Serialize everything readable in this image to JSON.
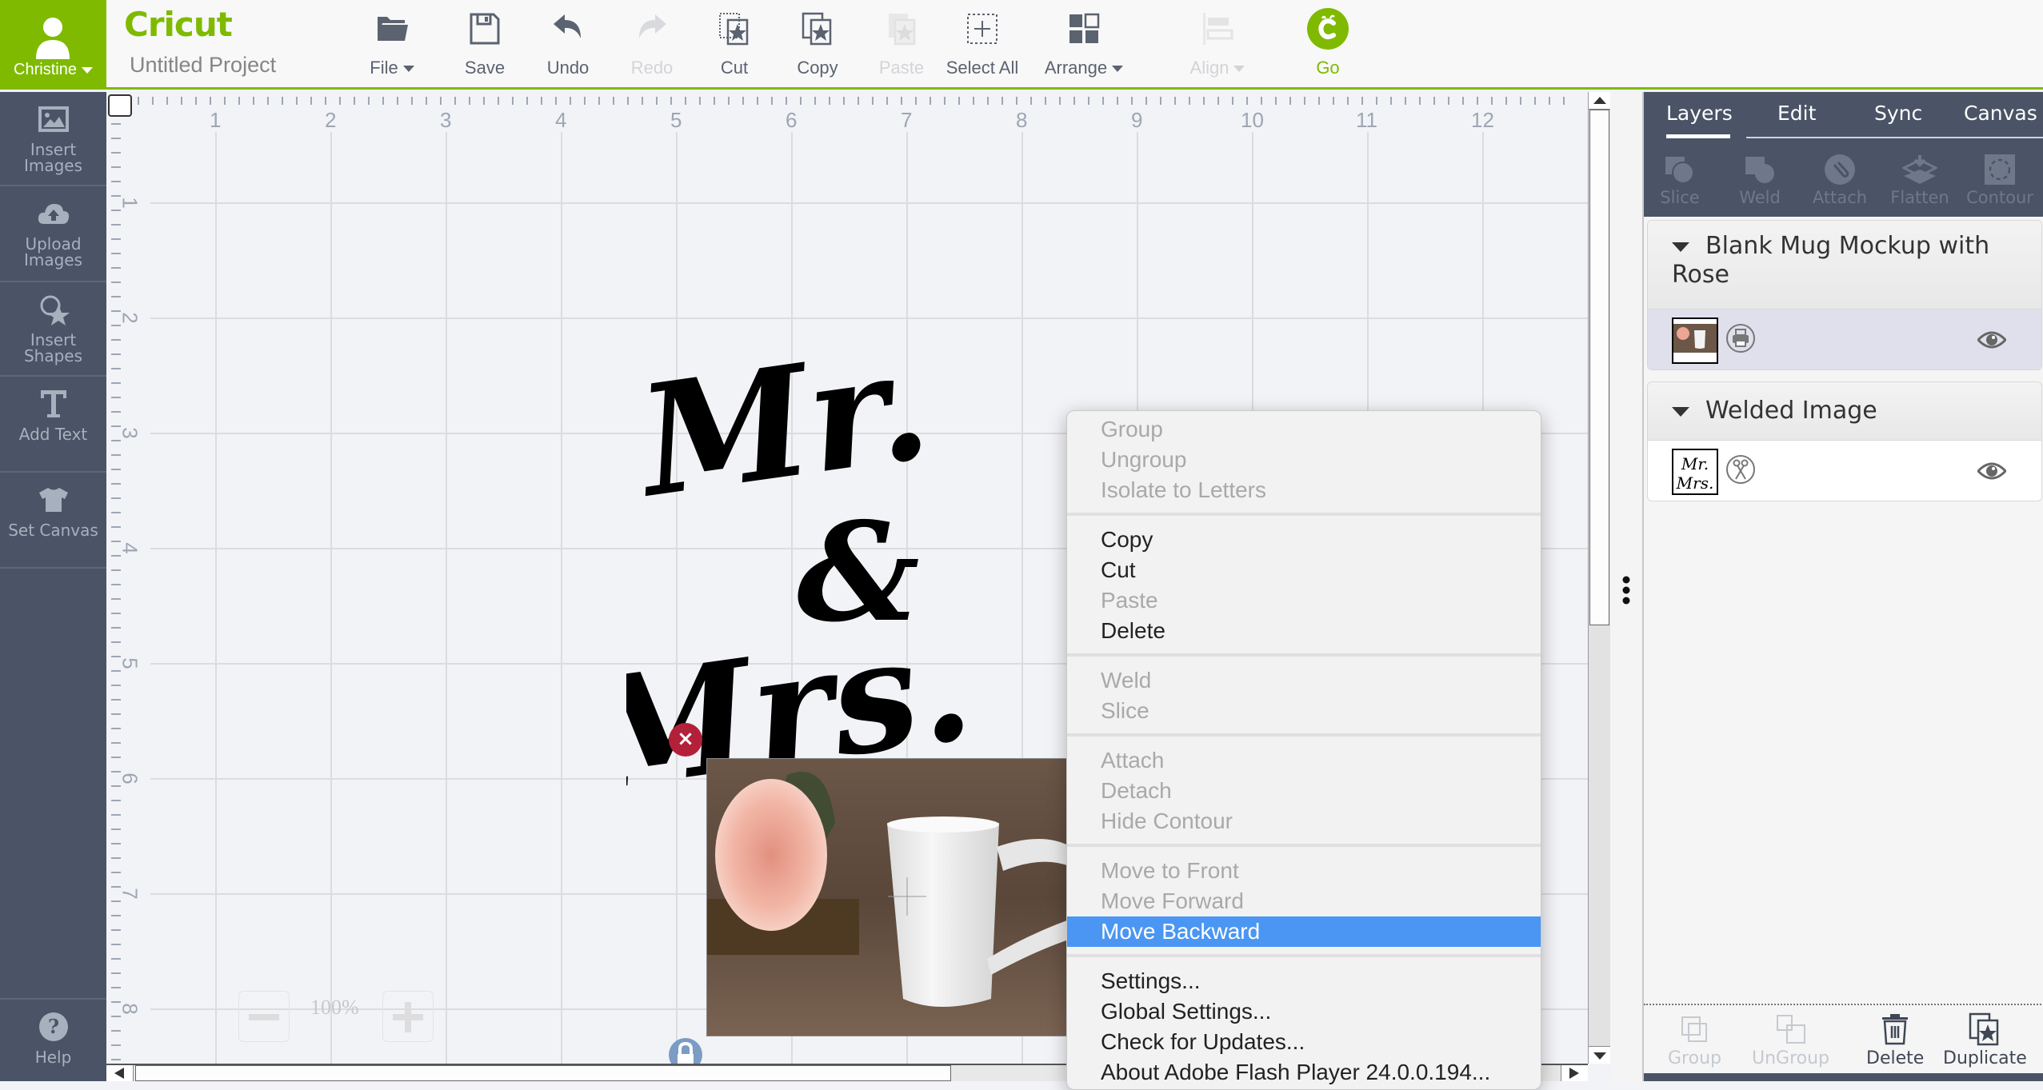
{
  "user": {
    "name": "Christine",
    "icon": "user-icon"
  },
  "app": {
    "logo": "Cricut",
    "project_title": "Untitled Project"
  },
  "toolbar": [
    {
      "label": "File",
      "icon": "folder-icon",
      "dropdown": true,
      "enabled": true
    },
    {
      "label": "Save",
      "icon": "save-icon",
      "dropdown": false,
      "enabled": true
    },
    {
      "label": "Undo",
      "icon": "undo-icon",
      "dropdown": false,
      "enabled": true
    },
    {
      "label": "Redo",
      "icon": "redo-icon",
      "dropdown": false,
      "enabled": false
    },
    {
      "label": "Cut",
      "icon": "cut-icon",
      "dropdown": false,
      "enabled": true
    },
    {
      "label": "Copy",
      "icon": "copy-icon",
      "dropdown": false,
      "enabled": true
    },
    {
      "label": "Paste",
      "icon": "paste-icon",
      "dropdown": false,
      "enabled": false
    },
    {
      "label": "Select All",
      "icon": "select-all-icon",
      "dropdown": false,
      "enabled": true
    },
    {
      "label": "Arrange",
      "icon": "arrange-icon",
      "dropdown": true,
      "enabled": true
    },
    {
      "label": "Align",
      "icon": "align-icon",
      "dropdown": true,
      "enabled": false
    },
    {
      "label": "Go",
      "icon": "cricut-go-icon",
      "dropdown": false,
      "enabled": true
    }
  ],
  "sidebar": {
    "items": [
      {
        "label": "Insert Images",
        "icon": "image-icon"
      },
      {
        "label": "Upload Images",
        "icon": "cloud-upload-icon"
      },
      {
        "label": "Insert Shapes",
        "icon": "shapes-icon"
      },
      {
        "label": "Add Text",
        "icon": "text-icon"
      },
      {
        "label": "Set Canvas",
        "icon": "tshirt-icon"
      }
    ],
    "help": {
      "label": "Help",
      "icon": "help-icon"
    }
  },
  "canvas": {
    "ruler_h": [
      "1",
      "2",
      "3",
      "4",
      "5",
      "6",
      "7",
      "8",
      "9",
      "10",
      "11",
      "12"
    ],
    "ruler_v": [
      "1",
      "2",
      "3",
      "4",
      "5",
      "6",
      "7",
      "8"
    ],
    "zoom_level": "100%",
    "design_text": [
      "Mr.",
      "&",
      "Mrs."
    ]
  },
  "right_panel": {
    "tabs": [
      {
        "label": "Layers",
        "active": true
      },
      {
        "label": "Edit",
        "active": false
      },
      {
        "label": "Sync",
        "active": false
      },
      {
        "label": "Canvas",
        "active": false
      }
    ],
    "tools": [
      {
        "label": "Slice",
        "icon": "slice-icon"
      },
      {
        "label": "Weld",
        "icon": "weld-icon"
      },
      {
        "label": "Attach",
        "icon": "attach-icon"
      },
      {
        "label": "Flatten",
        "icon": "flatten-icon"
      },
      {
        "label": "Contour",
        "icon": "contour-icon"
      }
    ],
    "layers": [
      {
        "title": "Blank Mug Mockup with Rose",
        "op_icon": "print-icon",
        "selected": true,
        "visible": true
      },
      {
        "title": "Welded Image",
        "op_icon": "scissors-icon",
        "selected": false,
        "visible": true
      }
    ],
    "bottom_actions": [
      {
        "label": "Group",
        "icon": "group-icon",
        "enabled": false
      },
      {
        "label": "UnGroup",
        "icon": "ungroup-icon",
        "enabled": false
      },
      {
        "label": "Delete",
        "icon": "trash-icon",
        "enabled": true
      },
      {
        "label": "Duplicate",
        "icon": "duplicate-icon",
        "enabled": true
      }
    ]
  },
  "context_menu": {
    "items": [
      {
        "label": "Group",
        "enabled": false
      },
      {
        "label": "Ungroup",
        "enabled": false
      },
      {
        "label": "Isolate to Letters",
        "enabled": false
      },
      {
        "separator": true
      },
      {
        "label": "Copy",
        "enabled": true
      },
      {
        "label": "Cut",
        "enabled": true
      },
      {
        "label": "Paste",
        "enabled": false
      },
      {
        "label": "Delete",
        "enabled": true
      },
      {
        "separator": true
      },
      {
        "label": "Weld",
        "enabled": false
      },
      {
        "label": "Slice",
        "enabled": false
      },
      {
        "separator": true
      },
      {
        "label": "Attach",
        "enabled": false
      },
      {
        "label": "Detach",
        "enabled": false
      },
      {
        "label": "Hide Contour",
        "enabled": false
      },
      {
        "separator": true
      },
      {
        "label": "Move to Front",
        "enabled": false
      },
      {
        "label": "Move Forward",
        "enabled": false
      },
      {
        "label": "Move Backward",
        "enabled": true,
        "highlighted": true
      },
      {
        "separator": true
      },
      {
        "label": "Settings...",
        "enabled": true
      },
      {
        "label": "Global Settings...",
        "enabled": true
      },
      {
        "label": "Check for Updates...",
        "enabled": true
      },
      {
        "label": "About Adobe Flash Player 24.0.0.194...",
        "enabled": true
      }
    ]
  },
  "colors": {
    "brand_green": "#7fba00",
    "sidebar": "#4a5466",
    "highlight": "#4a96f2",
    "close_red": "#b3203a"
  }
}
